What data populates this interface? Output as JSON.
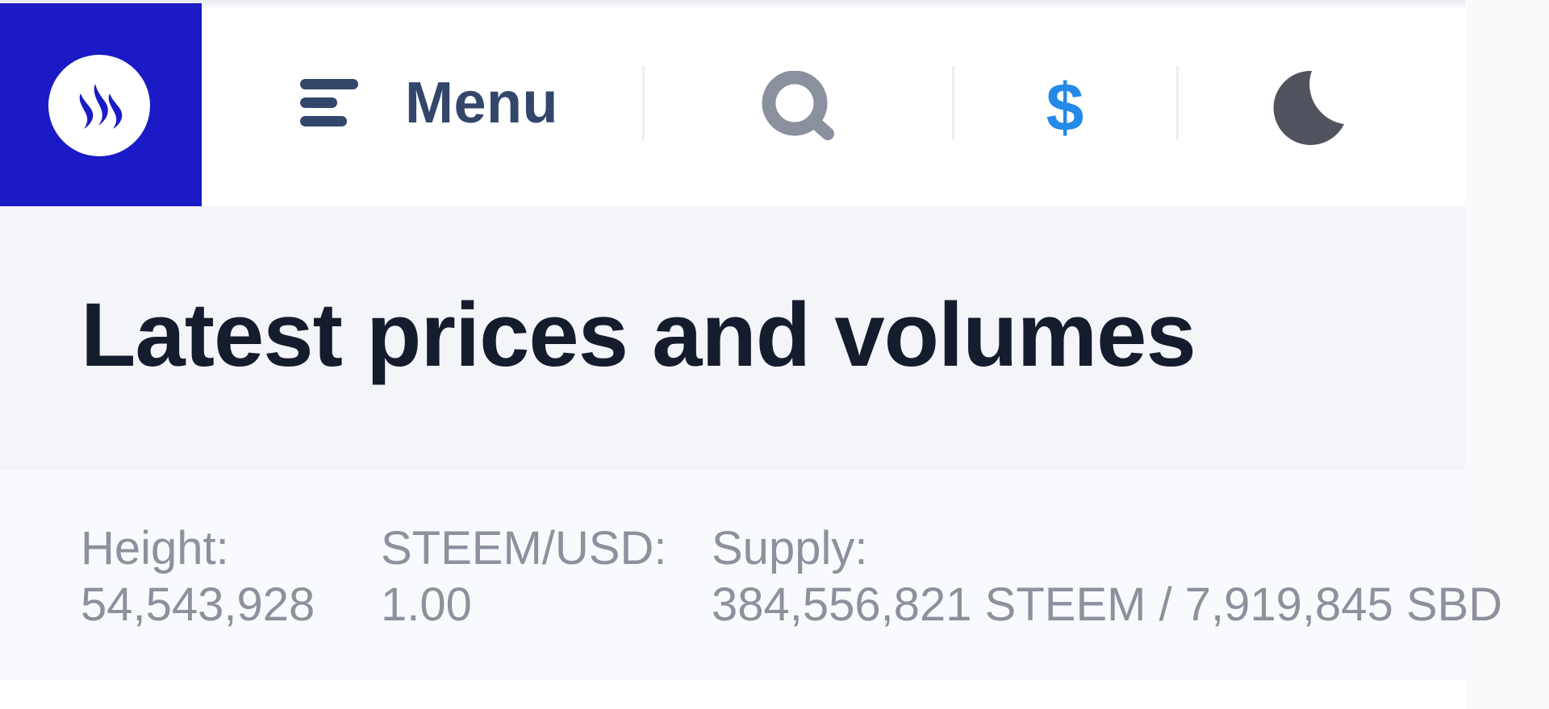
{
  "header": {
    "logo_icon": "steem-logo-icon",
    "menu_icon": "menu-icon",
    "menu_label": "Menu",
    "search_icon": "search-icon",
    "currency_symbol": "$",
    "theme_icon": "moon-icon"
  },
  "colors": {
    "brand": "#1a1ac6",
    "menu_text": "#33476b",
    "currency": "#2489e8",
    "title": "#151c2e",
    "muted": "#8d919e"
  },
  "page": {
    "title": "Latest prices and volumes"
  },
  "stats": {
    "height_label": "Height:",
    "height_value": "54,543,928",
    "price_label": "STEEM/USD:",
    "price_value": "1.00",
    "supply_label": "Supply:",
    "supply_value": "384,556,821 STEEM / 7,919,845 SBD"
  }
}
